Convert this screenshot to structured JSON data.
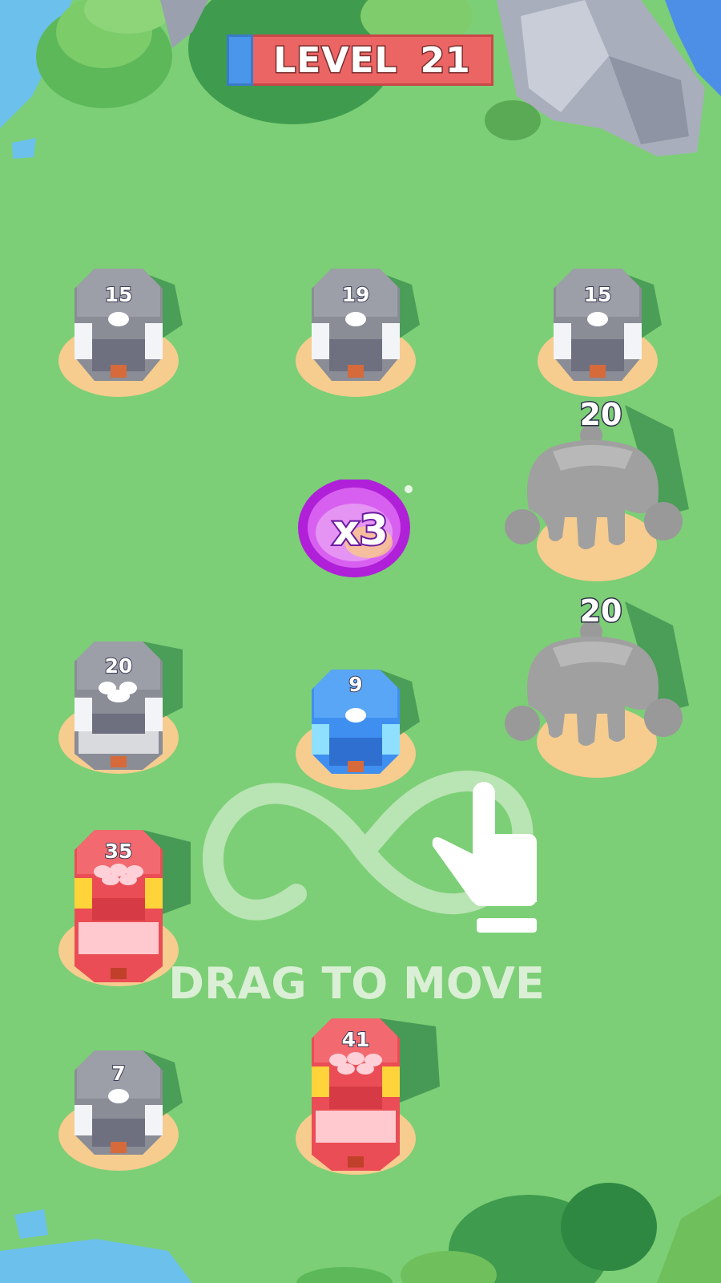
{
  "hud": {
    "level_label": "LEVEL",
    "level_number": "21"
  },
  "colors": {
    "grass": "#7ccf76",
    "water": "#6cc0ec",
    "gray_tower": "#8a8c96",
    "blue_tower": "#3f8ff0",
    "red_tower": "#ea4d55",
    "multiplier": "#b020d8",
    "level_bar": "#ec6565",
    "level_progress": "#4a96ea"
  },
  "towers": [
    {
      "id": "gray-1",
      "count": "15",
      "color": "gray"
    },
    {
      "id": "gray-2",
      "count": "19",
      "color": "gray"
    },
    {
      "id": "gray-3",
      "count": "15",
      "color": "gray"
    },
    {
      "id": "gray-4",
      "count": "20",
      "color": "gray"
    },
    {
      "id": "blue-1",
      "count": "9",
      "color": "blue"
    },
    {
      "id": "red-1",
      "count": "35",
      "color": "red"
    },
    {
      "id": "gray-5",
      "count": "7",
      "color": "gray"
    },
    {
      "id": "red-2",
      "count": "41",
      "color": "red"
    }
  ],
  "rocks": [
    {
      "id": "rock-1",
      "count": "20"
    },
    {
      "id": "rock-2",
      "count": "20"
    }
  ],
  "multiplier": {
    "label": "x3"
  },
  "tutorial": {
    "text": "DRAG TO MOVE",
    "gesture_icon": "pointing-hand-icon",
    "path_icon": "infinity-path-icon"
  }
}
